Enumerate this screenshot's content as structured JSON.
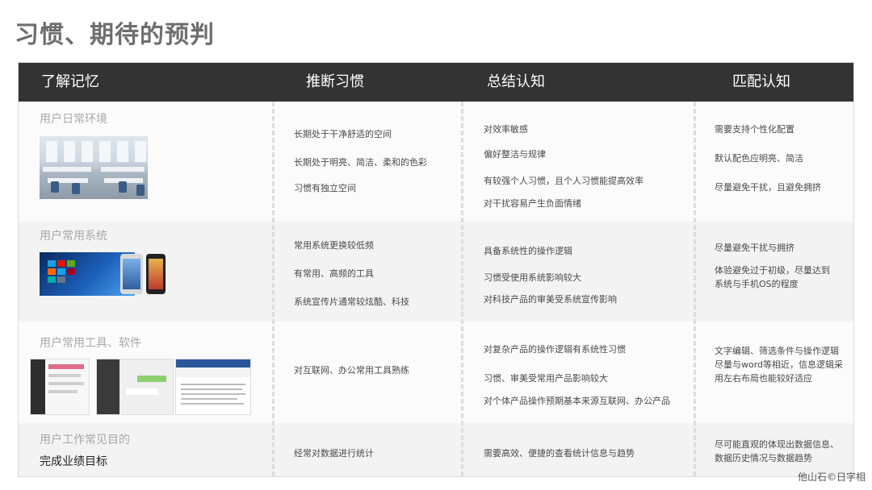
{
  "page_title": "习惯、期待的预判",
  "headers": [
    "了解记忆",
    "推断习惯",
    "总结认知",
    "匹配认知"
  ],
  "rows": [
    {
      "title": "用户日常环境",
      "col2": [
        "长期处于干净舒适的空间",
        "长期处于明亮、简洁、柔和的色彩",
        "习惯有独立空间"
      ],
      "col3": [
        "对效率敏感",
        "偏好整洁与规律",
        "有较强个人习惯，且个人习惯能提高效率",
        "对干扰容易产生负面情绪"
      ],
      "col4": [
        "需要支持个性化配置",
        "默认配色应明亮、简洁",
        "尽量避免干扰，且避免拥挤"
      ]
    },
    {
      "title": "用户常用系统",
      "col2": [
        "常用系统更换较低频",
        "有常用、高频的工具",
        "系统宣传片通常较炫酷、科技"
      ],
      "col3": [
        "具备系统性的操作逻辑",
        "习惯受使用系统影响较大",
        "对科技产品的审美受系统宣传影响"
      ],
      "col4": [
        "尽量避免干扰与拥挤",
        "体验避免过于初级，尽量达到",
        "系统与手机OS的程度"
      ]
    },
    {
      "title": "用户常用工具、软件",
      "col2": [
        "对互联网、办公常用工具熟练"
      ],
      "col3": [
        "对复杂产品的操作逻辑有系统性习惯",
        "习惯、审美受常用产品影响较大",
        "对个体产品操作预期基本来源互联网、办公产品"
      ],
      "col4": [
        "文字编辑、筛选条件与操作逻辑",
        "尽量与word等相近，信息逻辑采",
        "用左右布局也能较好适应"
      ]
    },
    {
      "title": "用户工作常见目的",
      "goal": "完成业绩目标",
      "col2": [
        "经常对数据进行统计"
      ],
      "col3": [
        "需要高效、便捷的查看统计信息与趋势"
      ],
      "col4": [
        "尽可能直观的体现出数据信息、",
        "数据历史情况与数据趋势"
      ]
    }
  ],
  "footnote": "他山石©日字相"
}
